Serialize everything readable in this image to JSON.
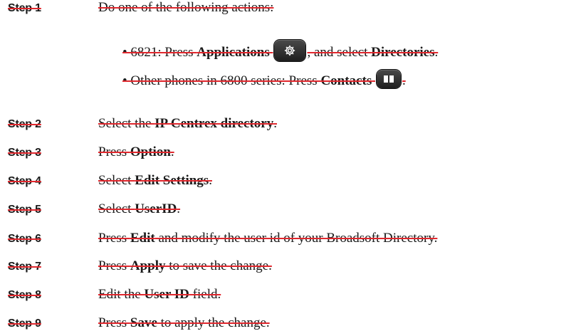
{
  "steps": [
    {
      "label": "Step 1",
      "text": "Do one of the following actions:"
    },
    {
      "label": "Step 2",
      "pre": "Select the ",
      "bold": "IP Centrex directory",
      "post": "."
    },
    {
      "label": "Step 3",
      "pre": "Press ",
      "bold": "Option",
      "post": "."
    },
    {
      "label": "Step 4",
      "pre": "Select ",
      "bold": "Edit Settings",
      "post": "."
    },
    {
      "label": "Step 5",
      "pre": "Select ",
      "bold": "UserID",
      "post": "."
    },
    {
      "label": "Step 6",
      "pre": "Press ",
      "bold": "Edit",
      "post": " and modify the user id of your Broadsoft Directory."
    },
    {
      "label": "Step 7",
      "pre": "Press ",
      "bold": "Apply",
      "post": " to save the change."
    },
    {
      "label": "Step 8",
      "pre": "Edit the ",
      "bold": "User ID",
      "post": " field."
    },
    {
      "label": "Step 9",
      "pre": "Press ",
      "bold": "Save",
      "post": " to apply the change."
    }
  ],
  "bullets": [
    {
      "pre": "• 6821: Press ",
      "bold1": "Applications",
      "icon": "gear-icon",
      "mid": ", and select ",
      "bold2": "Directories",
      "post": "."
    },
    {
      "pre": "• Other phones in 6800 series: Press ",
      "bold1": "Contacts",
      "icon": "contacts-book-icon",
      "post": "."
    }
  ]
}
